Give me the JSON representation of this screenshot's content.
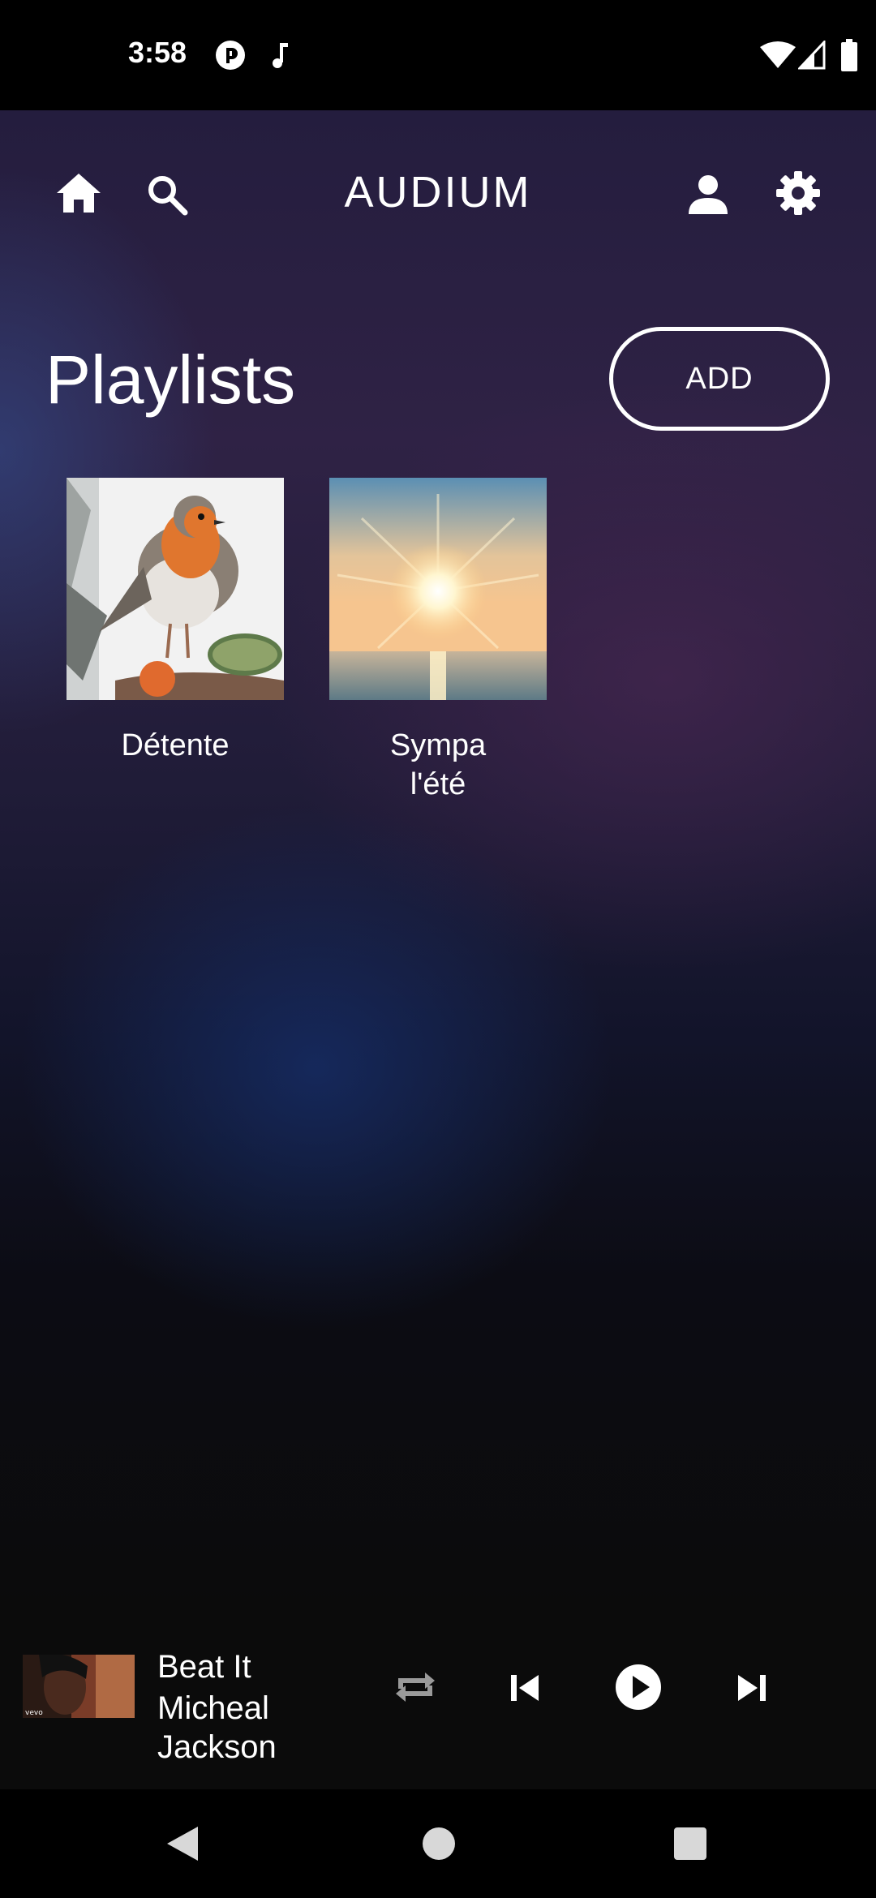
{
  "status_bar": {
    "time": "3:58",
    "icons_left": [
      "pocket-casts-icon",
      "music-note-icon"
    ],
    "icons_right": [
      "wifi-icon",
      "cellular-signal-icon",
      "battery-icon"
    ]
  },
  "header": {
    "title": "AUDIUM",
    "left_icons": [
      "home-icon",
      "search-icon"
    ],
    "right_icons": [
      "account-icon",
      "settings-icon"
    ]
  },
  "playlists": {
    "heading": "Playlists",
    "add_label": "ADD",
    "items": [
      {
        "name": "Détente",
        "thumbnail": "robin-bird-image"
      },
      {
        "name": "Sympa l'été",
        "thumbnail": "sunset-sea-image"
      }
    ]
  },
  "now_playing": {
    "title": "Beat It",
    "artist": "Micheal Jackson",
    "thumbnail": "video-thumbnail",
    "controls": [
      "repeat-icon",
      "skip-previous-icon",
      "play-icon",
      "skip-next-icon"
    ]
  },
  "system_nav": [
    "back-icon",
    "home-circle-icon",
    "recents-icon"
  ],
  "colors": {
    "background_top": "#241d3e",
    "background_bottom": "#0b0b0b",
    "player_background": "#0b0b0b",
    "text": "#ffffff"
  }
}
